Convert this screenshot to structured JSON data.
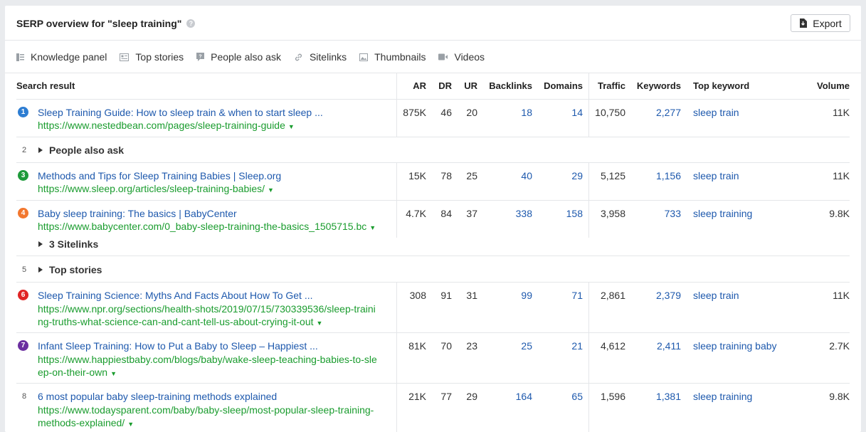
{
  "header": {
    "title": "SERP overview for \"sleep training\"",
    "help": "?"
  },
  "export_label": "Export",
  "features": [
    {
      "label": "Knowledge panel",
      "icon": "knowledge-panel-icon"
    },
    {
      "label": "Top stories",
      "icon": "top-stories-icon"
    },
    {
      "label": "People also ask",
      "icon": "people-also-ask-icon"
    },
    {
      "label": "Sitelinks",
      "icon": "sitelinks-icon"
    },
    {
      "label": "Thumbnails",
      "icon": "thumbnails-icon"
    },
    {
      "label": "Videos",
      "icon": "videos-icon"
    }
  ],
  "columns": {
    "result": "Search result",
    "ar": "AR",
    "dr": "DR",
    "ur": "UR",
    "backlinks": "Backlinks",
    "domains": "Domains",
    "traffic": "Traffic",
    "keywords": "Keywords",
    "top_keyword": "Top keyword",
    "volume": "Volume"
  },
  "colors": {
    "link": "#1e59ad",
    "url": "#1a9c2e",
    "badge_blue": "#2d7dd2",
    "badge_green": "#1e9a3a",
    "badge_orange": "#f2772e",
    "badge_red": "#e02424",
    "badge_purple": "#6b2fa0"
  },
  "rows": [
    {
      "pos": "1",
      "title": "Sleep Training Guide: How to sleep train & when to start sleep ...",
      "url1": "https://www.nestedbean.com/pages/sleep-training-guide",
      "url2": "",
      "ar": "875K",
      "dr": "46",
      "ur": "20",
      "backlinks": "18",
      "domains": "14",
      "traffic": "10,750",
      "keywords": "2,277",
      "top_keyword": "sleep train",
      "volume": "11K"
    },
    {
      "pos": "2",
      "label": "People also ask"
    },
    {
      "pos": "3",
      "title": "Methods and Tips for Sleep Training Babies | Sleep.org",
      "url1": "https://www.sleep.org/articles/sleep-training-babies/",
      "url2": "",
      "ar": "15K",
      "dr": "78",
      "ur": "25",
      "backlinks": "40",
      "domains": "29",
      "traffic": "5,125",
      "keywords": "1,156",
      "top_keyword": "sleep train",
      "volume": "11K"
    },
    {
      "pos": "4",
      "title": "Baby sleep training: The basics | BabyCenter",
      "url1": "https://www.babycenter.com/0_baby-sleep-training-the-basics_1505715.bc",
      "url2": "",
      "sitelinks": "3 Sitelinks",
      "ar": "4.7K",
      "dr": "84",
      "ur": "37",
      "backlinks": "338",
      "domains": "158",
      "traffic": "3,958",
      "keywords": "733",
      "top_keyword": "sleep training",
      "volume": "9.8K"
    },
    {
      "pos": "5",
      "label": "Top stories"
    },
    {
      "pos": "6",
      "title": "Sleep Training Science: Myths And Facts About How To Get ...",
      "url1": "https://www.npr.org/sections/health-shots/2019/07/15/730339536/sleep-traini",
      "url2": "ng-truths-what-science-can-and-cant-tell-us-about-crying-it-out",
      "ar": "308",
      "dr": "91",
      "ur": "31",
      "backlinks": "99",
      "domains": "71",
      "traffic": "2,861",
      "keywords": "2,379",
      "top_keyword": "sleep train",
      "volume": "11K"
    },
    {
      "pos": "7",
      "title": "Infant Sleep Training: How to Put a Baby to Sleep – Happiest ...",
      "url1": "https://www.happiestbaby.com/blogs/baby/wake-sleep-teaching-babies-to-sle",
      "url2": "ep-on-their-own",
      "ar": "81K",
      "dr": "70",
      "ur": "23",
      "backlinks": "25",
      "domains": "21",
      "traffic": "4,612",
      "keywords": "2,411",
      "top_keyword": "sleep training baby",
      "volume": "2.7K"
    },
    {
      "pos": "8",
      "title": "6 most popular baby sleep-training methods explained",
      "url1": "https://www.todaysparent.com/baby/baby-sleep/most-popular-sleep-training-",
      "url2": "methods-explained/",
      "ar": "21K",
      "dr": "77",
      "ur": "29",
      "backlinks": "164",
      "domains": "65",
      "traffic": "1,596",
      "keywords": "1,381",
      "top_keyword": "sleep training",
      "volume": "9.8K"
    }
  ]
}
